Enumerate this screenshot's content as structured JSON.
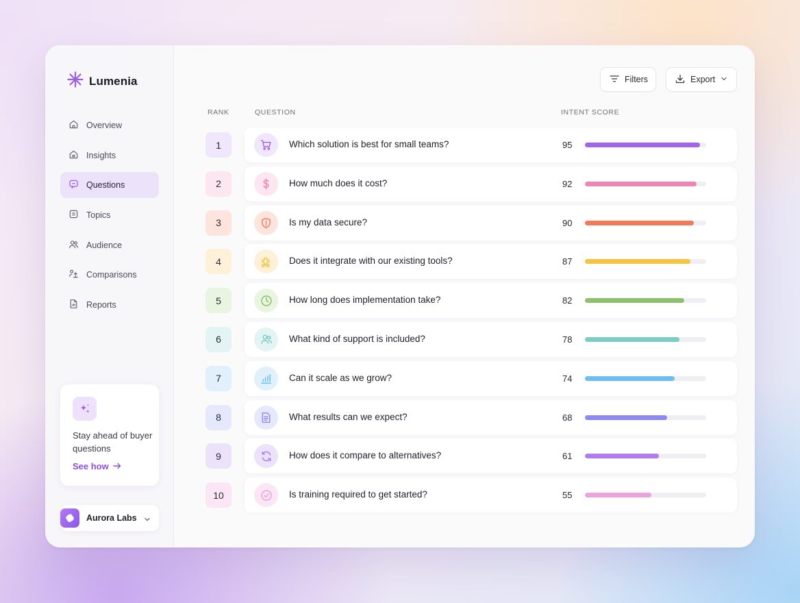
{
  "brand": {
    "name": "Lumenia",
    "accent": "#9b5de5"
  },
  "nav": [
    {
      "label": "Overview",
      "icon": "home-icon",
      "active": false
    },
    {
      "label": "Insights",
      "icon": "insights-home-icon",
      "active": false
    },
    {
      "label": "Questions",
      "icon": "chat-icon",
      "active": true
    },
    {
      "label": "Topics",
      "icon": "bookmark-box-icon",
      "active": false
    },
    {
      "label": "Audience",
      "icon": "users-icon",
      "active": false
    },
    {
      "label": "Comparisons",
      "icon": "compare-icon",
      "active": false
    },
    {
      "label": "Reports",
      "icon": "report-icon",
      "active": false
    }
  ],
  "promo": {
    "text": "Stay ahead of buyer questions",
    "link": "See how"
  },
  "workspace": {
    "name": "Aurora Labs"
  },
  "toolbar": {
    "filters_label": "Filters",
    "export_label": "Export"
  },
  "columns": {
    "rank": "RANK",
    "question": "QUESTION",
    "intent_score": "INTENT SCORE"
  },
  "questions": [
    {
      "rank": "1",
      "text": "Which solution is best for small teams?",
      "score": "95",
      "icon": "cart-icon",
      "color": "#a066e6",
      "tint": "#f1e7fd"
    },
    {
      "rank": "2",
      "text": "How much does it cost?",
      "score": "92",
      "icon": "dollar-icon",
      "color": "#ee86b4",
      "tint": "#fde6ef"
    },
    {
      "rank": "3",
      "text": "Is my data secure?",
      "score": "90",
      "icon": "shield-icon",
      "color": "#f07a5a",
      "tint": "#fde4dd"
    },
    {
      "rank": "4",
      "text": "Does it integrate with our existing tools?",
      "score": "87",
      "icon": "puzzle-icon",
      "color": "#f5c541",
      "tint": "#fdf1d9"
    },
    {
      "rank": "5",
      "text": "How long does implementation take?",
      "score": "82",
      "icon": "clock-icon",
      "color": "#8fc06b",
      "tint": "#e9f4e1"
    },
    {
      "rank": "6",
      "text": "What kind of support is included?",
      "score": "78",
      "icon": "users-icon",
      "color": "#7fcbc6",
      "tint": "#e2f4f3"
    },
    {
      "rank": "7",
      "text": "Can it scale as we grow?",
      "score": "74",
      "icon": "bar-chart-icon",
      "color": "#6cbdf1",
      "tint": "#e1f1fb"
    },
    {
      "rank": "8",
      "text": "What results can we expect?",
      "score": "68",
      "icon": "document-icon",
      "color": "#8d8aef",
      "tint": "#e6e8fb"
    },
    {
      "rank": "9",
      "text": "How does it compare to alternatives?",
      "score": "61",
      "icon": "refresh-icon",
      "color": "#b07df0",
      "tint": "#ece3fb"
    },
    {
      "rank": "10",
      "text": "Is training required to get started?",
      "score": "55",
      "icon": "check-circle-icon",
      "color": "#eaa3dc",
      "tint": "#fbe6f6"
    }
  ]
}
